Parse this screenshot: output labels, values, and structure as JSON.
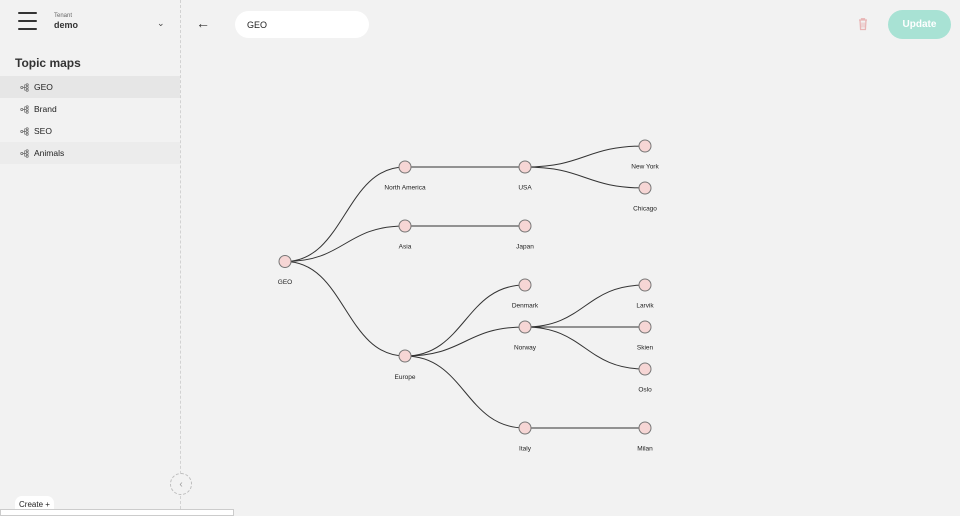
{
  "sidebar": {
    "tenant_label": "Tenant",
    "tenant_name": "demo",
    "heading": "Topic maps",
    "items": [
      {
        "label": "GEO",
        "active": true
      },
      {
        "label": "Brand"
      },
      {
        "label": "SEO"
      },
      {
        "label": "Animals"
      }
    ],
    "create_label": "Create +"
  },
  "header": {
    "title_value": "GEO",
    "update_label": "Update",
    "delete_icon": "trash-icon",
    "back_icon": "arrow-left-icon"
  },
  "tree": {
    "root": "GEO",
    "level1": [
      "North America",
      "Asia",
      "Europe"
    ],
    "level2": [
      "USA",
      "Japan",
      "Denmark",
      "Norway",
      "Italy"
    ],
    "level3": [
      "New York",
      "Chicago",
      "Larvik",
      "Skien",
      "Oslo",
      "Milan"
    ]
  },
  "colors": {
    "node_fill": "#f6d6d5",
    "node_stroke": "#777777",
    "update_button": "#a8e2d4",
    "delete_icon": "#e8b5b5"
  }
}
